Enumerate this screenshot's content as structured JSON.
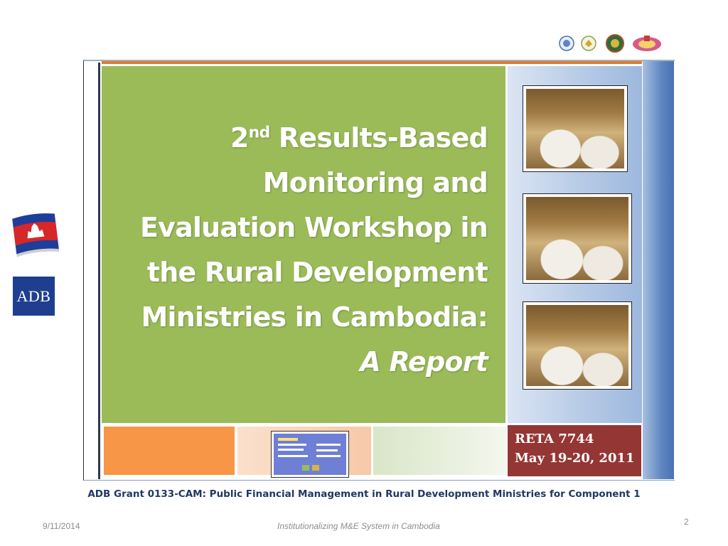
{
  "cover": {
    "title_number": "2",
    "title_ordinal": "nd",
    "title_line1_rest": " Results-Based",
    "title_line2": "Monitoring and",
    "title_line3": "Evaluation Workshop in",
    "title_line4": "the Rural Development",
    "title_line5": "Ministries in Cambodia:",
    "title_line6": "A Report",
    "reta_line1": "RETA 7744",
    "reta_line2": "May 19-20, 2011",
    "green_color": "#9bbb59",
    "red_color": "#943634",
    "orange_color": "#f79646"
  },
  "left_logos": {
    "adb_text": "ADB"
  },
  "caption": "ADB Grant 0133-CAM: Public Financial Management in Rural Development Ministries for Component 1",
  "footer": {
    "date": "9/11/2014",
    "title": "Institutionalizing M&E System in Cambodia",
    "page": "2"
  },
  "icons": {
    "top_right": [
      "ministry-seal-icon",
      "emblem-seal-icon",
      "national-seal-icon",
      "royal-crest-icon"
    ],
    "left": [
      "cambodia-flag-icon",
      "adb-logo"
    ]
  }
}
